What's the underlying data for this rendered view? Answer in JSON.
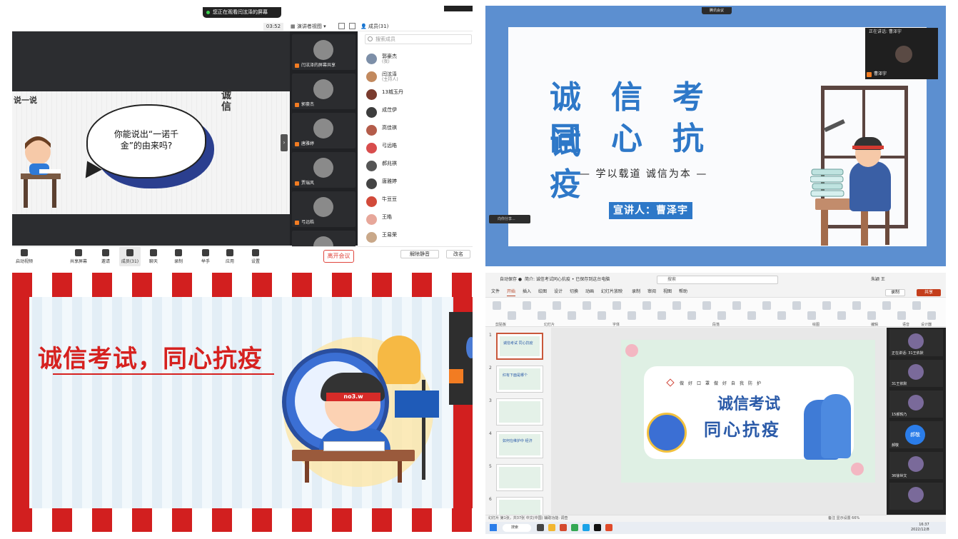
{
  "q1": {
    "banner": "您正在观看闫泫泽的屏幕",
    "timer": "03:52",
    "view_mode": "演讲者视图",
    "members_title": "成员(31)",
    "search_placeholder": "搜索成员",
    "slide_title": "说一说",
    "deco_chars": "诚信",
    "bubble_text": "你能说出“一诺千金”的由来吗?",
    "video_tiles": [
      {
        "name": "闫泫泽的屏幕共享"
      },
      {
        "name": "郭豪杰"
      },
      {
        "name": "唐雅婷"
      },
      {
        "name": "贾瑞风"
      },
      {
        "name": "弓远皓"
      },
      {
        "name": ""
      }
    ],
    "members": [
      {
        "name": "郭豪杰",
        "sub": "(我)",
        "color": "#7d8fa8"
      },
      {
        "name": "闫泫泽",
        "sub": "(主持人)",
        "color": "#c2895e"
      },
      {
        "name": "13城玉丹",
        "sub": "",
        "color": "#7a3b2e"
      },
      {
        "name": "成茳伊",
        "sub": "",
        "color": "#3d3d3d"
      },
      {
        "name": "高佳祺",
        "sub": "",
        "color": "#b45c4a"
      },
      {
        "name": "弓远皓",
        "sub": "",
        "color": "#d84d4d"
      },
      {
        "name": "郝兆祺",
        "sub": "",
        "color": "#555555"
      },
      {
        "name": "唐雅婷",
        "sub": "",
        "color": "#444444"
      },
      {
        "name": "牛豆豆",
        "sub": "",
        "color": "#d24a3a"
      },
      {
        "name": "王皓",
        "sub": "",
        "color": "#e7a79a"
      },
      {
        "name": "王易荣",
        "sub": "",
        "color": "#c9a889"
      }
    ],
    "bottom_buttons": [
      {
        "label": "启动视频"
      },
      {
        "label": "共享屏幕"
      },
      {
        "label": "邀请"
      },
      {
        "label": "成员(31)"
      },
      {
        "label": "聊天"
      },
      {
        "label": "录制"
      },
      {
        "label": "举手"
      },
      {
        "label": "应用"
      },
      {
        "label": "设置"
      }
    ],
    "leave_label": "离开会议",
    "unmute_all": "解除静音",
    "rename": "改名"
  },
  "q2": {
    "meet_badge": "腾讯会议",
    "title_line1": "诚信考试",
    "title_line2": "同心抗疫",
    "subtitle": "— 学以载道 诚信为本 —",
    "presenter": "宣讲人：曹泽宇",
    "speaking_label": "正在讲话: 曹泽宇",
    "speaker_name": "曹泽宇",
    "share_bar": "向你分享..."
  },
  "q3": {
    "title": "诚信考试，同心抗疫",
    "headband": "no3.w"
  },
  "q4": {
    "autosave": "自动保存",
    "filename": "简介: 诚信考试同心抗疫 • 已保存到这台电脑",
    "search": "搜索",
    "user": "朱颖 王",
    "tabs": [
      "文件",
      "开始",
      "插入",
      "绘图",
      "设计",
      "切换",
      "动画",
      "幻灯片放映",
      "录制",
      "审阅",
      "视图",
      "帮助"
    ],
    "record_btn": "录制",
    "share_btn": "共享",
    "ribbon_groups": [
      "剪贴板",
      "幻灯片",
      "字体",
      "段落",
      "绘图",
      "编辑",
      "语音",
      "设计器"
    ],
    "thumb_texts": [
      "诚信考试 同心抗疫",
      "红有下面是哪个",
      "",
      "如何在维护中 经济",
      "",
      ""
    ],
    "tagline": "做好口罩做好自我防护",
    "slide_t1": "诚信考试",
    "slide_t2": "同心抗疫",
    "right_panel": [
      {
        "name": "正在讲话: 31王依默",
        "kind": "avatar"
      },
      {
        "name": "31王依默",
        "kind": "avatar"
      },
      {
        "name": "15郝轶乃",
        "kind": "avatar"
      },
      {
        "name": "郝敬",
        "kind": "bubble",
        "bubble": "郝敬"
      },
      {
        "name": "36徐世文",
        "kind": "avatar"
      },
      {
        "name": "",
        "kind": "avatar"
      }
    ],
    "status_left": "幻灯片 第1张，共37张  中文(中国)  辅助功能: 调查",
    "status_right": "备注  显示设置  66%",
    "taskbar_search": "搜索",
    "time": "16:37",
    "date": "2022/12/8"
  }
}
